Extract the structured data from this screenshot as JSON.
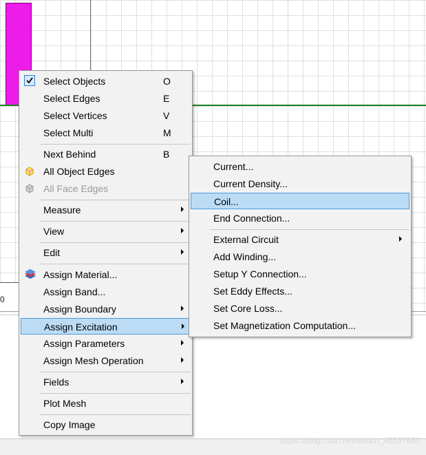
{
  "colors": {
    "menu_bg": "#f2f2f2",
    "highlight": "#bcdcf5",
    "highlight_border": "#4b9adb",
    "object_fill": "#ee1ce8",
    "green_line": "#15821e"
  },
  "canvas": {
    "axis_label": "0"
  },
  "context_menu": {
    "items": [
      {
        "label": "Select Objects",
        "shortcut": "O",
        "checked": true
      },
      {
        "label": "Select Edges",
        "shortcut": "E"
      },
      {
        "label": "Select Vertices",
        "shortcut": "V"
      },
      {
        "label": "Select Multi",
        "shortcut": "M"
      },
      {
        "label": "Next Behind",
        "shortcut": "B"
      },
      {
        "label": "All Object Edges",
        "icon": "edges-cube-icon"
      },
      {
        "label": "All Face Edges",
        "icon": "faces-cube-icon",
        "disabled": true
      },
      {
        "label": "Measure",
        "submenu": true
      },
      {
        "label": "View",
        "submenu": true
      },
      {
        "label": "Edit",
        "submenu": true
      },
      {
        "label": "Assign Material...",
        "icon": "material-layers-icon"
      },
      {
        "label": "Assign Band..."
      },
      {
        "label": "Assign Boundary",
        "submenu": true
      },
      {
        "label": "Assign Excitation",
        "submenu": true,
        "highlighted": true
      },
      {
        "label": "Assign Parameters",
        "submenu": true
      },
      {
        "label": "Assign Mesh Operation",
        "submenu": true
      },
      {
        "label": "Fields",
        "submenu": true
      },
      {
        "label": "Plot Mesh"
      },
      {
        "label": "Copy Image"
      }
    ]
  },
  "submenu": {
    "items": [
      {
        "label": "Current..."
      },
      {
        "label": "Current Density..."
      },
      {
        "label": "Coil...",
        "highlighted": true
      },
      {
        "label": "End Connection..."
      },
      {
        "label": "External Circuit",
        "submenu": true
      },
      {
        "label": "Add Winding..."
      },
      {
        "label": "Setup Y Connection..."
      },
      {
        "label": "Set Eddy Effects..."
      },
      {
        "label": "Set Core Loss..."
      },
      {
        "label": "Set Magnetization Computation..."
      }
    ]
  },
  "watermark": "https://blog.csdn.net/weixin_45597860"
}
